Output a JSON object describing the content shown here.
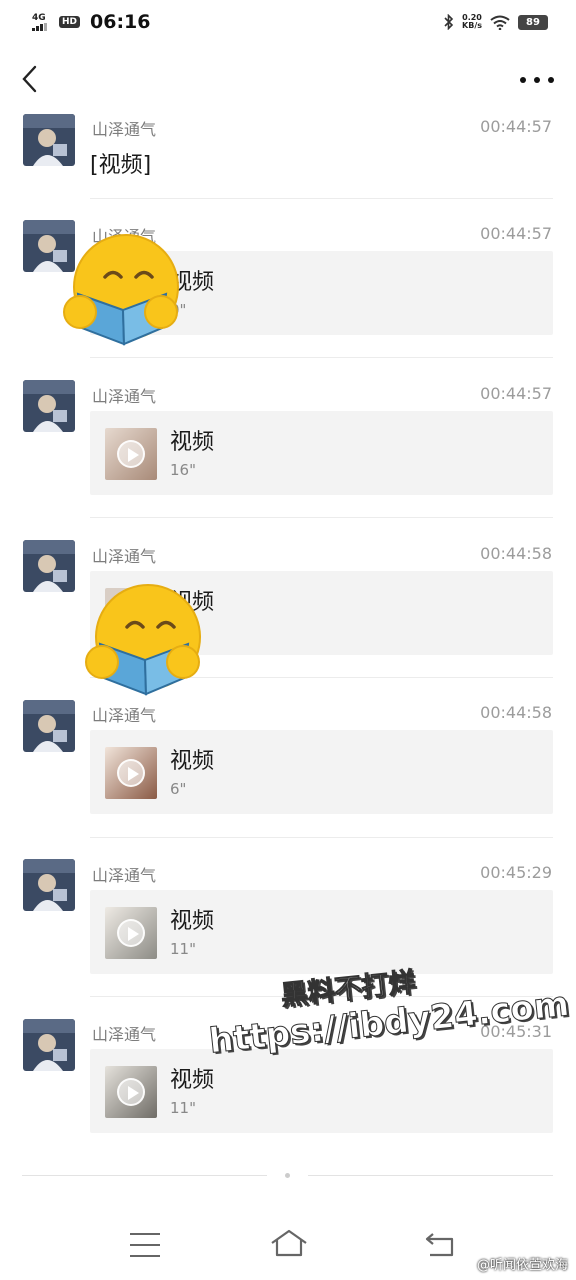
{
  "status_bar": {
    "network": "4G",
    "hd": "HD",
    "time": "06:16",
    "speed_value": "0.20",
    "speed_unit": "KB/s",
    "battery": "89"
  },
  "nav": {
    "back_icon": "chevron-left-icon",
    "more_icon": "more-dots-icon"
  },
  "messages": [
    {
      "sender": "山泽通气",
      "time": "00:44:57",
      "text": "[视频]"
    },
    {
      "sender": "山泽通气",
      "time": "00:44:57",
      "title": "视频",
      "duration": "0\""
    },
    {
      "sender": "山泽通气",
      "time": "00:44:57",
      "title": "视频",
      "duration": "16\""
    },
    {
      "sender": "山泽通气",
      "time": "00:44:58",
      "title": "视频",
      "duration": ""
    },
    {
      "sender": "山泽通气",
      "time": "00:44:58",
      "title": "视频",
      "duration": "6\""
    },
    {
      "sender": "山泽通气",
      "time": "00:45:29",
      "title": "视频",
      "duration": "11\""
    },
    {
      "sender": "山泽通气",
      "time": "00:45:31",
      "title": "视频",
      "duration": "11\""
    }
  ],
  "watermark": {
    "line1": "黑料不打烊",
    "line2": "https://ibdy24.com"
  },
  "credit": "@听闻依萱欢海",
  "colors": {
    "background": "#ffffff",
    "card": "#f3f3f3",
    "sticker": "#f9c51b"
  }
}
